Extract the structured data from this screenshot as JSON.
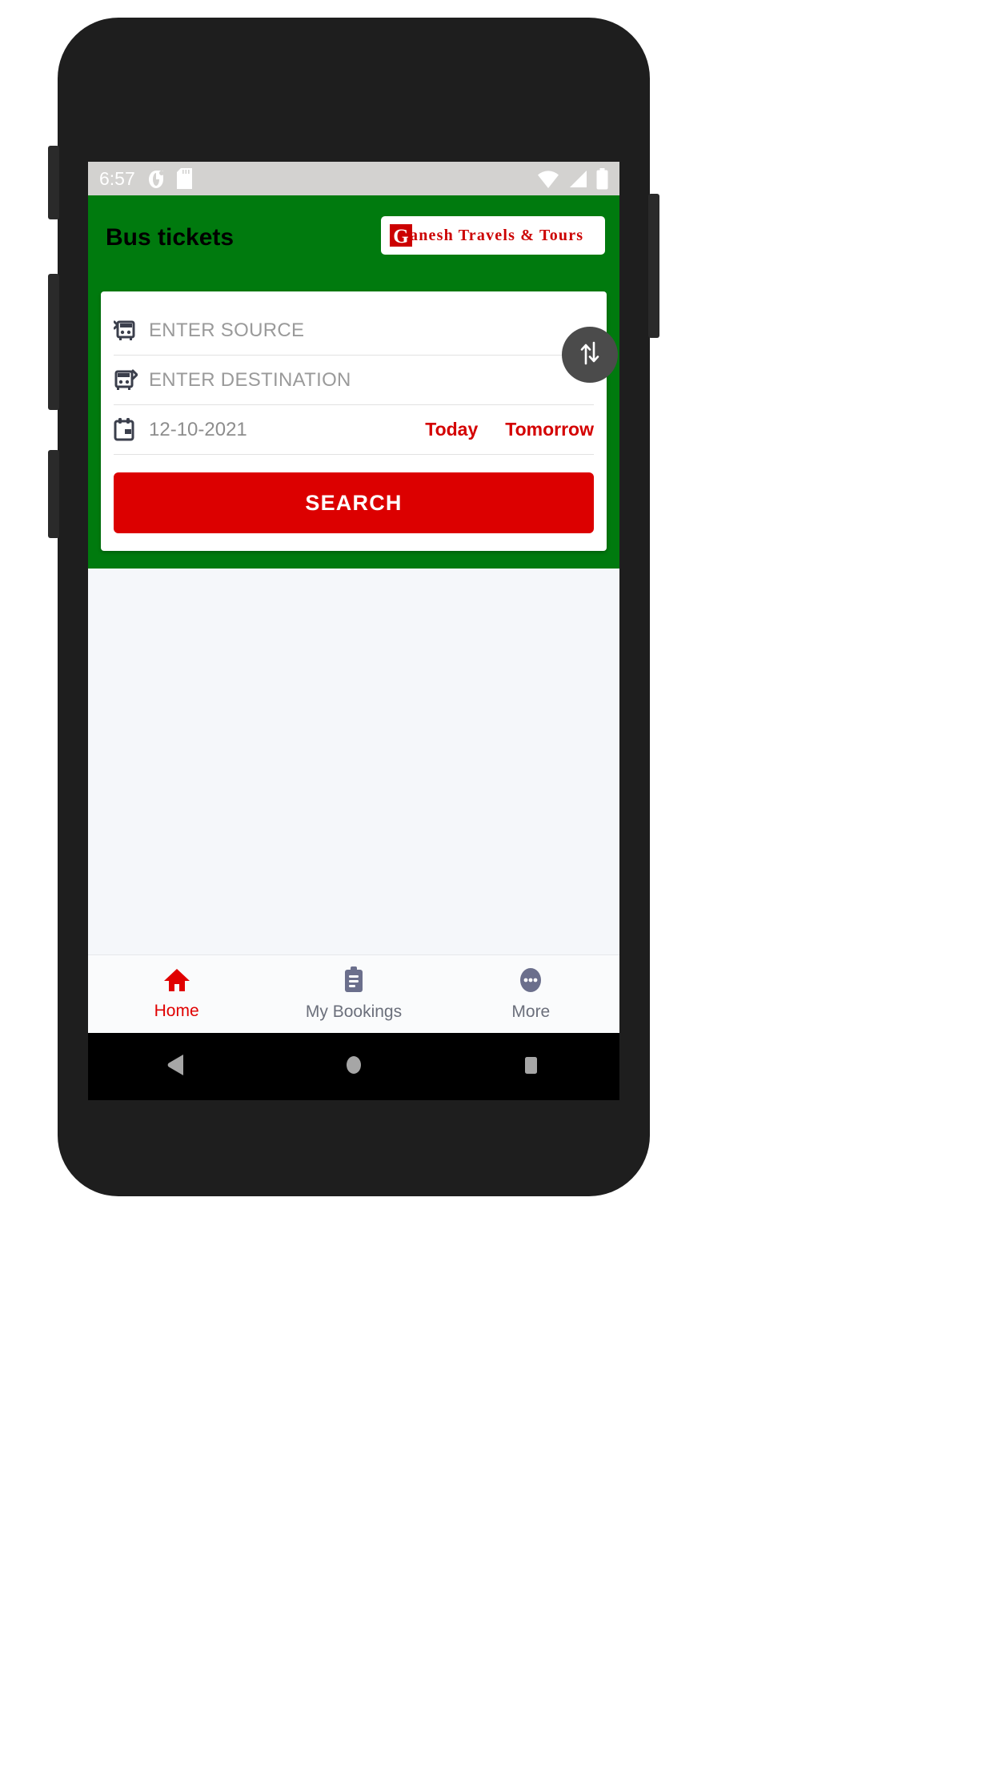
{
  "status_bar": {
    "time": "6:57",
    "left_icons": [
      "sim-card-icon",
      "sd-card-icon"
    ],
    "right_icons": [
      "wifi-icon",
      "cellular-signal-icon",
      "battery-icon"
    ],
    "background_color": "#d3d2d0"
  },
  "header": {
    "title": "Bus tickets",
    "background_color": "#007a0e",
    "title_color": "#000000",
    "logo": {
      "monogram": "G",
      "text": "anesh Travels & Tours",
      "color": "#cc0000"
    }
  },
  "search_card": {
    "source": {
      "icon": "bus-arrive-icon",
      "value": "",
      "placeholder": "ENTER SOURCE"
    },
    "destination": {
      "icon": "bus-depart-icon",
      "value": "",
      "placeholder": "ENTER DESTINATION"
    },
    "date": {
      "icon": "calendar-icon",
      "value": "12-10-2021",
      "quick_today": "Today",
      "quick_tomorrow": "Tomorrow",
      "quick_color": "#d40000"
    },
    "swap_button": {
      "icon": "swap-vertical-icon",
      "background_color": "#4b4b4b"
    },
    "search_button": {
      "label": "SEARCH",
      "background_color": "#dc0000",
      "text_color": "#ffffff"
    }
  },
  "bottom_nav": {
    "items": [
      {
        "label": "Home",
        "icon": "home-icon",
        "active": true
      },
      {
        "label": "My Bookings",
        "icon": "clipboard-icon",
        "active": false
      },
      {
        "label": "More",
        "icon": "more-dots-icon",
        "active": false
      }
    ],
    "active_color": "#e00000",
    "inactive_color": "#6b6f7b"
  },
  "android_nav": {
    "back": "back-triangle-icon",
    "home": "home-circle-icon",
    "recents": "recents-square-icon"
  }
}
